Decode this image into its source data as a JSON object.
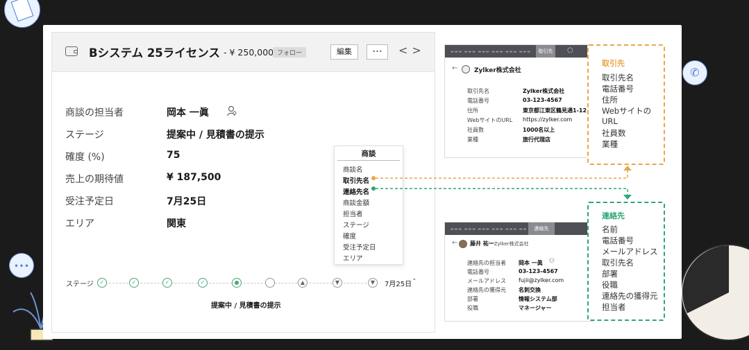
{
  "deal": {
    "title": "Bシステム 25ライセンス",
    "amount": "- ¥ 250,000",
    "follow_label": "フォロー",
    "edit_label": "編集",
    "more_label": "•••",
    "nav_arrows": "<>",
    "fields": [
      {
        "label": "商談の担当者",
        "value": "岡本 一眞"
      },
      {
        "label": "ステージ",
        "value": "提案中 / 見積書の提示"
      },
      {
        "label": "確度 (%)",
        "value": "75"
      },
      {
        "label": "売上の期待値",
        "value": "¥ 187,500"
      },
      {
        "label": "受注予定日",
        "value": "7月25日"
      },
      {
        "label": "エリア",
        "value": "関東"
      }
    ],
    "stage_bar": {
      "label": "ステージ",
      "date": "7月25日",
      "current_stage": "提案中 / 見積書の提示"
    }
  },
  "field_list": {
    "title": "商談",
    "items": [
      {
        "text": "商談名",
        "bold": false
      },
      {
        "text": "取引先名",
        "bold": true
      },
      {
        "text": "連絡先名",
        "bold": true
      },
      {
        "text": "商談金額",
        "bold": false
      },
      {
        "text": "担当者",
        "bold": false
      },
      {
        "text": "ステージ",
        "bold": false
      },
      {
        "text": "確度",
        "bold": false
      },
      {
        "text": "受注予定日",
        "bold": false
      },
      {
        "text": "エリア",
        "bold": false
      }
    ]
  },
  "account_window": {
    "tab_label": "取引先",
    "title": "Zylker株式会社",
    "rows": [
      {
        "key": "取引先名",
        "value": "Zylker株式会社"
      },
      {
        "key": "電話番号",
        "value": "03-123-4567"
      },
      {
        "key": "住所",
        "value": "東京都江東区鶴見通1-12"
      },
      {
        "key": "WebサイトのURL",
        "value": "https://zylker.com"
      },
      {
        "key": "社員数",
        "value": "1000名以上"
      },
      {
        "key": "業種",
        "value": "旅行代理店"
      }
    ]
  },
  "contact_window": {
    "tab_label": "連絡先",
    "title": "藤井 祐一",
    "subtitle": "- Zylker株式会社",
    "rows": [
      {
        "key": "連絡先の担当者",
        "value": "岡本 一眞"
      },
      {
        "key": "電話番号",
        "value": "03-123-4567"
      },
      {
        "key": "メールアドレス",
        "value": "fujii@zylker.com"
      },
      {
        "key": "連絡先の獲得元",
        "value": "名刺交換"
      },
      {
        "key": "部署",
        "value": "情報システム部"
      },
      {
        "key": "役職",
        "value": "マネージャー"
      }
    ]
  },
  "account_callout": {
    "title": "取引先",
    "items": [
      "取引先名",
      "電話番号",
      "住所",
      "Webサイトの",
      "URL",
      "社員数",
      "業種"
    ]
  },
  "contact_callout": {
    "title": "連絡先",
    "items": [
      "名前",
      "電話番号",
      "メールアドレス",
      "取引先名",
      "部署",
      "役職",
      "連絡先の獲得元",
      "担当者"
    ]
  },
  "colors": {
    "orange": "#e8a64a",
    "green": "#2ea676",
    "background": "#1b1b1b"
  }
}
